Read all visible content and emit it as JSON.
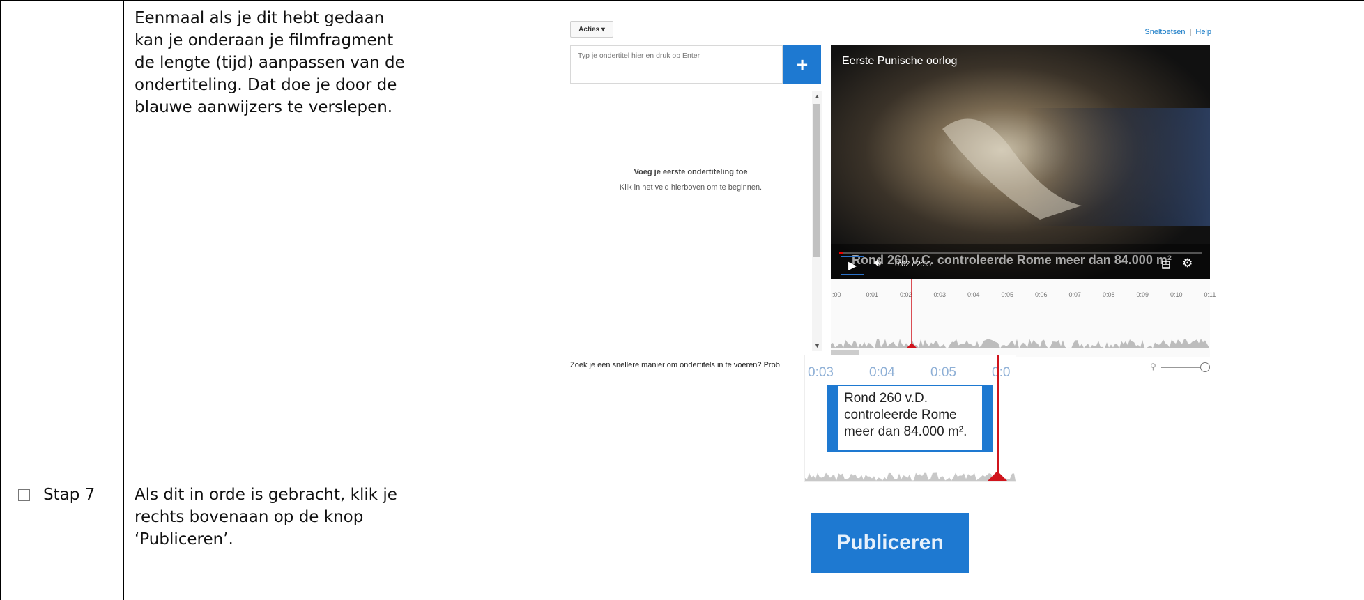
{
  "rows": [
    {
      "step": "",
      "text": "Eenmaal als je dit hebt gedaan\nkan je onderaan je filmfragment\nde lengte (tijd) aanpassen van de\nondertiteling. Dat doe je door de\nblauwe aanwijzers te verslepen."
    },
    {
      "step": "Stap 7",
      "text": "Als dit in orde is gebracht,  klik je\nrechts bovenaan op de knop\n‘Publiceren’."
    }
  ],
  "editor": {
    "actions_label": "Acties ▾",
    "shortcuts_link": "Sneltoetsen",
    "separator": "|",
    "help_link": "Help",
    "subtitle_placeholder": "Typ je ondertitel hier en druk op Enter",
    "add_button": "+",
    "empty_title": "Voeg je eerste ondertiteling toe",
    "empty_hint": "Klik in het veld hierboven om te beginnen.",
    "bottom_hint": "Zoek je een snellere manier om ondertitels in te voeren? Prob",
    "video_title": "Eerste Punische oorlog",
    "video_caption": "Rond 260 v.C. controleerde Rome meer dan 84.000 m²",
    "time_display": "0:02 / 2:55",
    "timeline_ticks": [
      ":00",
      "0:01",
      "0:02",
      "0:03",
      "0:04",
      "0:05",
      "0:06",
      "0:07",
      "0:08",
      "0:09",
      "0:10",
      "0:11"
    ],
    "zoom_ticks": [
      "0:03",
      "0:04",
      "0:05",
      "0:0"
    ],
    "cue_text": "Rond 260 v.D.\ncontroleerde Rome\nmeer dan 84.000 m².",
    "playhead_progress": 0.0114
  },
  "publish_label": "Publiceren",
  "colors": {
    "accent": "#1e79d1",
    "playhead": "#d0141c",
    "border": "#000000"
  }
}
